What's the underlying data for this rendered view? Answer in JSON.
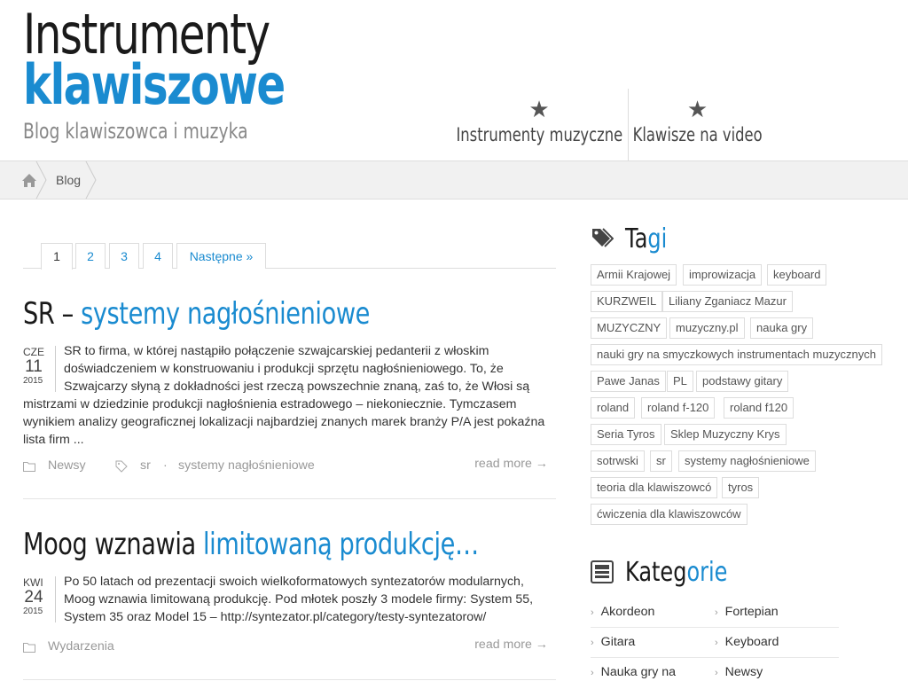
{
  "site": {
    "title_line1": "Instrumenty",
    "title_line2": "klawiszowe",
    "tagline": "Blog klawiszowca i muzyka"
  },
  "nav": [
    {
      "label": "Instrumenty muzyczne",
      "icon": "star-icon"
    },
    {
      "label": "Klawisze na video",
      "icon": "star-icon"
    }
  ],
  "breadcrumb": {
    "home_icon": "home-icon",
    "current": "Blog"
  },
  "pagination": [
    "1",
    "2",
    "3",
    "4",
    "Następne »"
  ],
  "posts": [
    {
      "title_dark": "SR – ",
      "title_blue": "systemy nagłośnieniowe",
      "date": {
        "month": "CZE",
        "day": "11",
        "year": "2015"
      },
      "excerpt": "SR to firma, w której nastąpiło połączenie szwajcarskiej pedanterii z włoskim doświadczeniem w konstruowaniu i produkcji sprzętu nagłośnieniowego. To, że Szwajcarzy słyną z dokładności jest rzeczą powszechnie znaną, zaś to, że Włosi są mistrzami w dziedzinie produkcji nagłośnienia estradowego – niekoniecznie. Tymczasem wynikiem analizy geograficznej lokalizacji najbardziej znanych marek branży P/A jest pokaźna lista firm ...",
      "category": "Newsy",
      "tags": [
        "sr",
        "systemy nagłośnieniowe"
      ],
      "read_more": "read more →"
    },
    {
      "title_dark": "Moog wznawia ",
      "title_blue": "limitowaną produkcję…",
      "date": {
        "month": "KWI",
        "day": "24",
        "year": "2015"
      },
      "excerpt": "Po 50 latach od prezentacji swoich wielkoformatowych syntezatorów modularnych, Moog wznawia limitowaną produkcję. Pod młotek poszły 3 modele firmy: System 55, System 35 oraz Model 15 – http://syntezator.pl/category/testy-syntezatorow/",
      "category": "Wydarzenia",
      "read_more": "read more →"
    }
  ],
  "sidebar": {
    "tags_title_dark": "Ta",
    "tags_title_blue": "gi",
    "tags": [
      "Armii Krajowej",
      "improwizacja",
      "keyboard",
      "KURZWEIL",
      "Liliany Zganiacz Mazur",
      "MUZYCZNY",
      "muzyczny.pl",
      "nauka gry",
      "nauki gry na smyczkowych instrumentach muzycznych",
      "Pawe Janas",
      "PL",
      "podstawy gitary",
      "roland",
      "roland f-120",
      "roland f120",
      "Seria Tyros",
      "Sklep Muzyczny Krys",
      "sotrwski",
      "sr",
      "systemy nagłośnieniowe",
      "teoria dla klawiszowcó",
      "tyros",
      "ćwiczenia dla klawiszowców"
    ],
    "cats_title_dark": "Kateg",
    "cats_title_blue": "orie",
    "categories": [
      "Akordeon",
      "Fortepian",
      "Gitara",
      "Keyboard",
      "Nauka gry na",
      "Newsy"
    ]
  }
}
